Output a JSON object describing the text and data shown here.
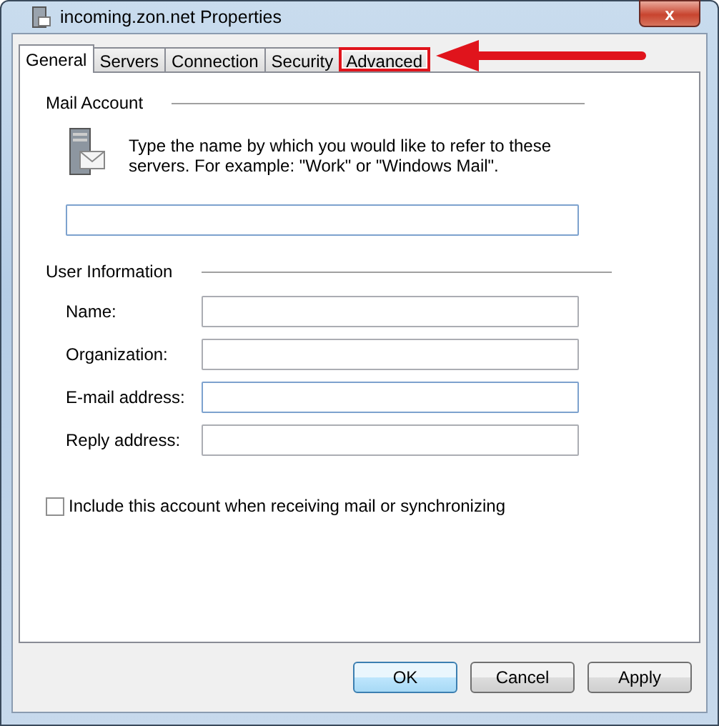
{
  "window": {
    "title": "incoming.zon.net Properties",
    "close_label": "x"
  },
  "tabs": [
    {
      "label": "General",
      "selected": true,
      "highlighted": false
    },
    {
      "label": "Servers",
      "selected": false,
      "highlighted": false
    },
    {
      "label": "Connection",
      "selected": false,
      "highlighted": false
    },
    {
      "label": "Security",
      "selected": false,
      "highlighted": false
    },
    {
      "label": "Advanced",
      "selected": false,
      "highlighted": true
    }
  ],
  "mail_account": {
    "heading": "Mail Account",
    "description": "Type the name by which you would like to refer to these servers.  For example: \"Work\" or \"Windows Mail\".",
    "field": {
      "focused": true
    }
  },
  "user_information": {
    "heading": "User Information",
    "fields": [
      {
        "label": "Name:",
        "focused": false
      },
      {
        "label": "Organization:",
        "focused": false
      },
      {
        "label": "E-mail address:",
        "focused": true
      },
      {
        "label": "Reply address:",
        "focused": false
      }
    ]
  },
  "include_checkbox": {
    "label": "Include this account when receiving mail or synchronizing",
    "checked": false
  },
  "buttons": [
    {
      "label": "OK",
      "default": true
    },
    {
      "label": "Cancel",
      "default": false
    },
    {
      "label": "Apply",
      "default": false
    }
  ]
}
